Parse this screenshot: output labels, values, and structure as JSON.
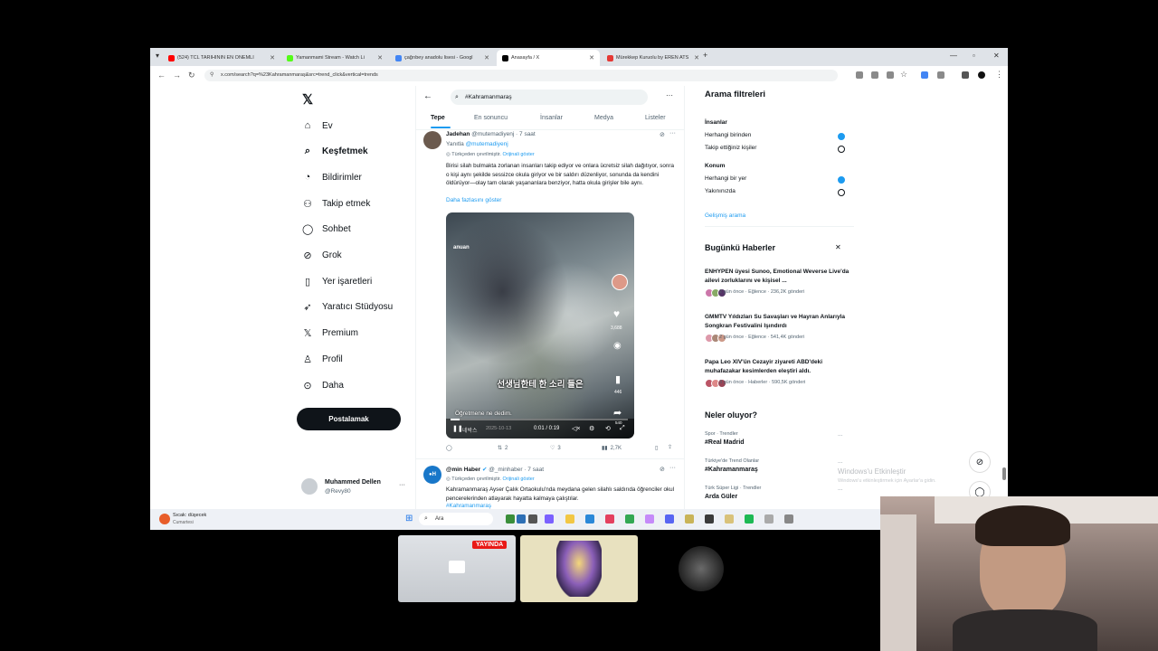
{
  "browser": {
    "tabs": [
      {
        "label": "(524) TCL TARİHİNİN EN ÖNEMLİ",
        "color": "#ff0000"
      },
      {
        "label": "Yamanmami Stream - Watch Li",
        "color": "#53fc18"
      },
      {
        "label": "çağrıbey anadolu lisesi - Googl",
        "color": "#4285f4"
      },
      {
        "label": "Anasayfa / X",
        "color": "#000000"
      },
      {
        "label": "Mürekkep Kuruolu by EREN ATS",
        "color": "#e53935"
      }
    ],
    "new_tab": "+",
    "url": "x.com/search?q=%23Kahramanmaraş&src=trend_click&vertical=trends"
  },
  "nav": {
    "logo": "𝕏",
    "items": [
      {
        "label": "Ev",
        "icon": "home-icon",
        "glyph": "⌂"
      },
      {
        "label": "Keşfetmek",
        "icon": "search-icon",
        "glyph": "⌕",
        "bold": true
      },
      {
        "label": "Bildirimler",
        "icon": "bell-icon",
        "glyph": "◔"
      },
      {
        "label": "Takip etmek",
        "icon": "follow-icon",
        "glyph": "⚇"
      },
      {
        "label": "Sohbet",
        "icon": "chat-icon",
        "glyph": "◯"
      },
      {
        "label": "Grok",
        "icon": "grok-icon",
        "glyph": "⊘"
      },
      {
        "label": "Yer işaretleri",
        "icon": "bookmark-icon",
        "glyph": "▯"
      },
      {
        "label": "Yaratıcı Stüdyosu",
        "icon": "rocket-icon",
        "glyph": "➶"
      },
      {
        "label": "Premium",
        "icon": "x-premium-icon",
        "glyph": "𝕏"
      },
      {
        "label": "Profil",
        "icon": "profile-icon",
        "glyph": "♙"
      },
      {
        "label": "Daha",
        "icon": "more-icon",
        "glyph": "⊙"
      }
    ],
    "post_label": "Postalamak",
    "account": {
      "name": "Muhammed Dellen",
      "handle": "@Revy80"
    }
  },
  "search": {
    "query": "#Kahramanmaraş",
    "tabs": [
      "Tepe",
      "En sonuncu",
      "İnsanlar",
      "Medya",
      "Listeler"
    ]
  },
  "tweet1": {
    "name": "Jadehan",
    "handle": "@mutemadiyenj · 7 saat",
    "reply_to_prefix": "Yanıtla",
    "reply_to": "@mutemadiyenj",
    "translated": "Türkçeden çevrilmiştir.",
    "show_original": "Orijinali göster",
    "text": "Birisi silah bulmakta zorlanan insanları takip ediyor ve onlara ücretsiz silah dağıtıyor, sonra o kişi aynı şekilde sessizce okula giriyor ve bir saldırı düzenliyor, sonunda da kendini öldürüyor—olay tam olarak yaşananlara benziyor, hatta okula girişler bile aynı.",
    "show_more": "Daha fazlasını göster",
    "video": {
      "watermark": "anuan",
      "subtitle_kr": "선생님한테 한 소리 들은",
      "subtitle_tr": "Öğretmene ne dedim.",
      "channel_label": "네박스",
      "date_label": "2025-10-13",
      "time": "0:01 / 0:19",
      "likes": "3,688",
      "saves": "446",
      "shares": "540",
      "progress": 0.05
    },
    "stats": {
      "replies": "",
      "reposts": "2",
      "likes": "3",
      "views": "2,7K"
    }
  },
  "tweet2": {
    "name": "@min Haber",
    "handle": "@_minhaber · 7 saat",
    "translated": "Türkçeden çevrilmiştir.",
    "show_original": "Orijinali göster",
    "text": "Kahramanmaraş Ayser Çalık Ortaokulu'nda meydana gelen silahlı saldırıda öğrenciler okul pencerelerinden atlayarak hayatta kalmaya çalıştılar.",
    "hashtag": "#Kahramanmaraş"
  },
  "filters": {
    "title": "Arama filtreleri",
    "people_title": "İnsanlar",
    "people_options": [
      {
        "label": "Herhangi birinden",
        "selected": true
      },
      {
        "label": "Takip ettiğiniz kişiler",
        "selected": false
      }
    ],
    "location_title": "Konum",
    "location_options": [
      {
        "label": "Herhangi bir yer",
        "selected": true
      },
      {
        "label": "Yakınınızda",
        "selected": false
      }
    ],
    "advanced": "Gelişmiş arama"
  },
  "news": {
    "title": "Bugünkü Haberler",
    "items": [
      {
        "title": "ENHYPEN üyesi Sunoo, Emotional Weverse Live'da ailevi zorluklarını ve kişisel ...",
        "meta": "2 gün önce · Eğlence · 236,2K gönderi"
      },
      {
        "title": "GMMTV Yıldızları Su Savaşları ve Hayran Anlarıyla Songkran Festivalini Işındırdı",
        "meta": "2 gün önce · Eğlence · 541,4K gönderi"
      },
      {
        "title": "Papa Leo XIV'ün Cezayir ziyareti ABD'deki muhafazakar kesimlerden eleştiri aldı.",
        "meta": "3 gün önce · Haberler · 590,5K gönderi"
      }
    ]
  },
  "trends": {
    "title": "Neler oluyor?",
    "items": [
      {
        "context": "Spor · Trendler",
        "name": "#Real Madrid"
      },
      {
        "context": "Türkiye'de Trend Olanlar",
        "name": "#Kahramanmaraş"
      },
      {
        "context": "Türk Süper Ligi · Trendler",
        "name": "Arda Güler"
      }
    ]
  },
  "windows_watermark": {
    "title": "Windows'u Etkinleştir",
    "sub": "Windows'u etkinleştirmek için Ayarlar'a gidin."
  },
  "taskbar": {
    "weather_title": "Sıcak: düşecek",
    "weather_sub": "Cumartesi",
    "search_placeholder": "Ara"
  },
  "stream": {
    "live_badge": "YAYINDA"
  },
  "colors": {
    "accent": "#1d9bf0",
    "live": "#e91916",
    "text": "#0f1419",
    "muted": "#536471"
  }
}
